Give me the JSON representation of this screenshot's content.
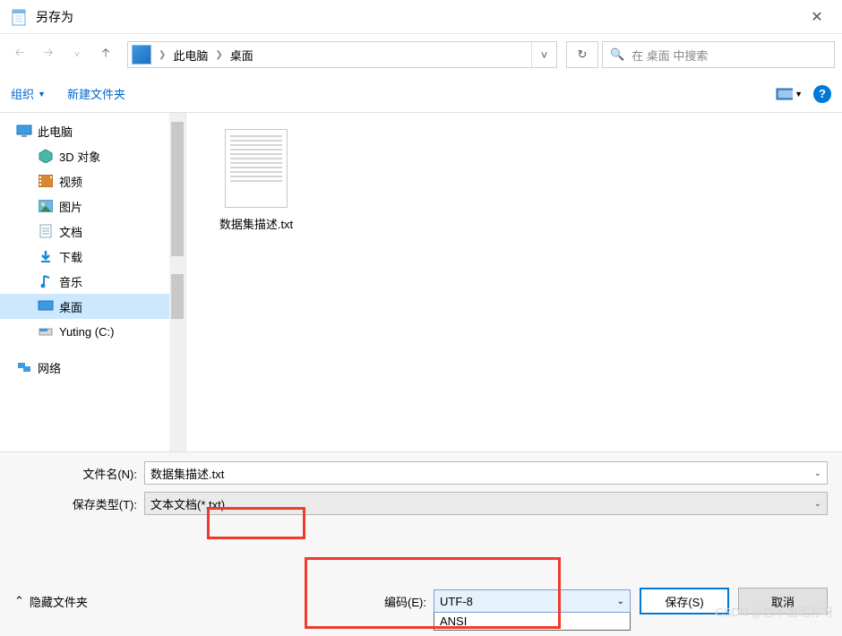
{
  "title": "另存为",
  "breadcrumb": {
    "root": "此电脑",
    "current": "桌面"
  },
  "search": {
    "placeholder": "在 桌面 中搜索"
  },
  "toolbar": {
    "organize": "组织",
    "newfolder": "新建文件夹"
  },
  "sidebar": {
    "root": "此电脑",
    "items": [
      "3D 对象",
      "视频",
      "图片",
      "文档",
      "下载",
      "音乐",
      "桌面",
      "Yuting (C:)"
    ],
    "network": "网络"
  },
  "file": {
    "name": "数据集描述.txt"
  },
  "form": {
    "filename_label": "文件名(N):",
    "filename_value": "数据集描述.txt",
    "type_label": "保存类型(T):",
    "type_value": "文本文档(*.txt)",
    "encoding_label": "编码(E):",
    "encoding_value": "UTF-8",
    "encoding_option": "ANSI"
  },
  "footer": {
    "hide": "隐藏文件夹",
    "save": "保存(S)",
    "cancel": "取消"
  },
  "watermark": "CSDN @想不出昵称呀"
}
